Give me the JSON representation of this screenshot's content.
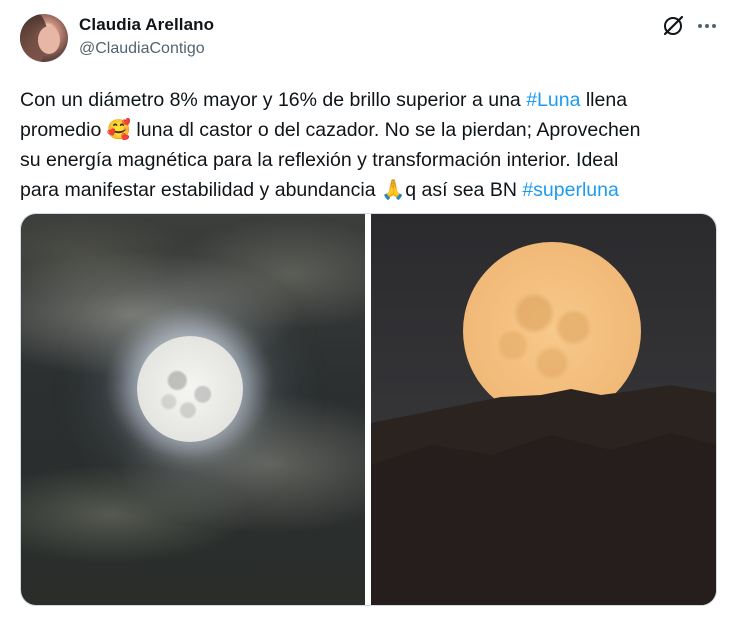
{
  "author": {
    "name": "Claudia Arellano",
    "handle": "@ClaudiaContigo"
  },
  "actions": {
    "grok_icon": "grok-icon",
    "more_icon": "more-horizontal-icon"
  },
  "tweet": {
    "line1_a": "Con un diámetro 8% mayor y 16% de brillo superior a una ",
    "line1_tag": "#Luna",
    "line1_b": " llena",
    "line2_a": "promedio ",
    "line2_emoji": "🥰",
    "line2_b": " luna dl castor o del cazador. No se la pierdan; Aprovechen",
    "line3": "su energía magnética para la reflexión y transformación interior. Ideal",
    "line4_a": "para manifestar estabilidad y abundancia ",
    "line4_emoji": "🙏",
    "line4_b": "q así sea BN ",
    "line4_tag": "#superluna"
  },
  "colors": {
    "link": "#1d9bf0",
    "text": "#0f1419",
    "secondary": "#536471"
  }
}
